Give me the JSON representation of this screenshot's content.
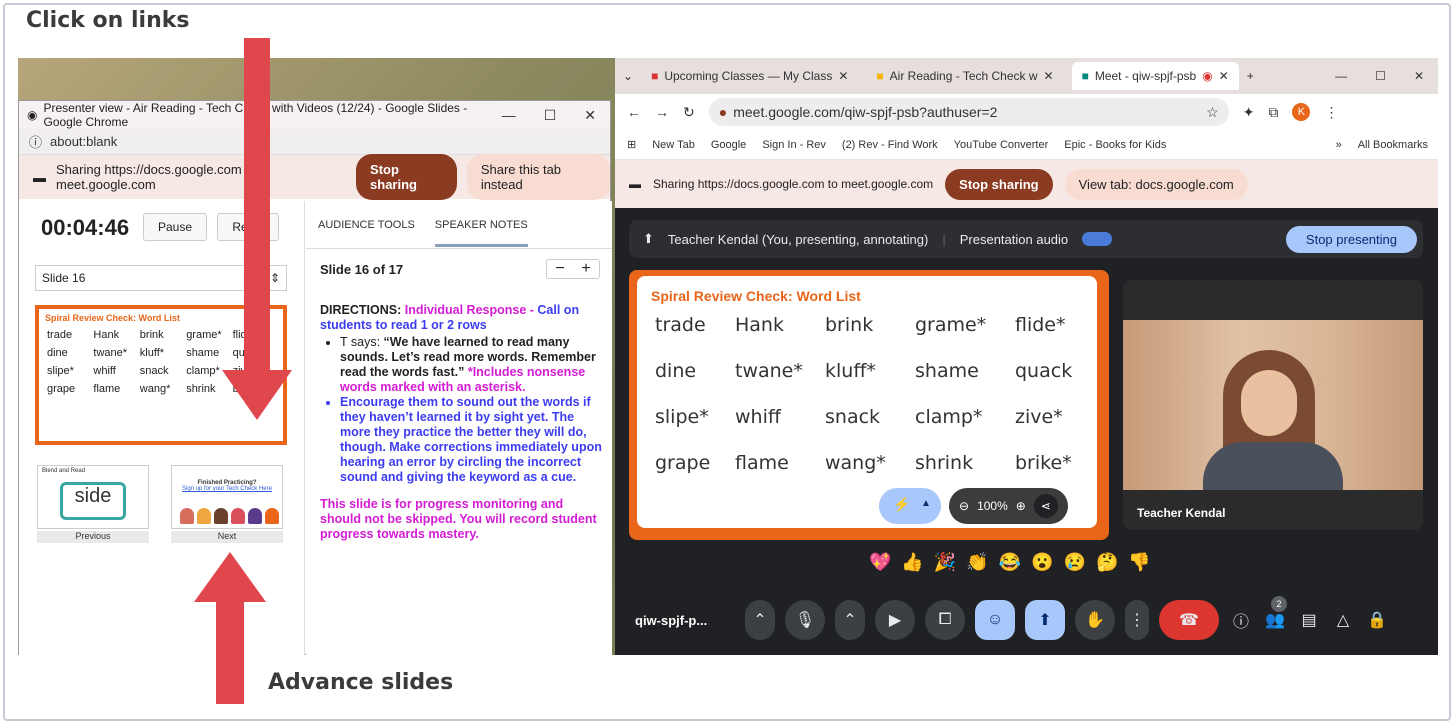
{
  "callouts": {
    "top": "Click on links",
    "bottom": "Advance slides"
  },
  "presenter": {
    "window_title": "Presenter view - Air Reading - Tech Check with Videos (12/24) - Google Slides - Google Chrome",
    "address": "about:blank",
    "share_text": "Sharing https://docs.google.com to meet.google.com",
    "stop_sharing": "Stop sharing",
    "share_tab": "Share this tab instead",
    "timer": "00:04:46",
    "pause": "Pause",
    "reset": "Reset",
    "slide_select": "Slide 16",
    "tabs": [
      "AUDIENCE TOOLS",
      "SPEAKER NOTES"
    ],
    "slide_counter": "Slide 16 of 17",
    "prev_label": "Previous",
    "next_label": "Next",
    "prev_slide_word": "side",
    "next_slide_title": "Finished Practicing?",
    "next_slide_link": "Sign up for your Tech Check Here",
    "prev_slide_title": "Blend and Read",
    "notes": {
      "directions": "DIRECTIONS:",
      "individual": "Individual Response -",
      "call": "Call on students to read 1 or 2 rows",
      "t_says": "T says:",
      "quote": "“We have learned to read many sounds. Let’s read more words. Remember read the words fast.”",
      "nonsense": "*Includes nonsense words marked with an asterisk.",
      "encourage": "Encourage them to sound out the words if they haven’t learned it by sight yet. The more they practice the better they will do, though. Make corrections immediately upon hearing an error by circling the incorrect sound and giving the keyword as a cue.",
      "progress": "This slide is for progress monitoring and should not be skipped. You will record student progress towards mastery."
    }
  },
  "slide": {
    "title": "Spiral Review Check: Word List",
    "words": [
      "trade",
      "Hank",
      "brink",
      "grame*",
      "flide*",
      "dine",
      "twane*",
      "kluff*",
      "shame",
      "quack",
      "slipe*",
      "whiff",
      "snack",
      "clamp*",
      "zive*",
      "grape",
      "flame",
      "wang*",
      "shrink",
      "brike*"
    ]
  },
  "meet": {
    "tabs": [
      "Upcoming Classes — My Class",
      "Air Reading - Tech Check w",
      "Meet - qiw-spjf-psb"
    ],
    "url": "meet.google.com/qiw-spjf-psb?authuser=2",
    "bookmarks": [
      "New Tab",
      "Google",
      "Sign In - Rev",
      "(2) Rev - Find Work",
      "YouTube Converter",
      "Epic - Books for Kids"
    ],
    "all_bookmarks": "All Bookmarks",
    "share_text": "Sharing https://docs.google.com to meet.google.com",
    "stop_sharing": "Stop sharing",
    "view_tab": "View tab: docs.google.com",
    "presenting": "Teacher Kendal (You, presenting, annotating)",
    "presentation_audio": "Presentation audio",
    "stop_presenting": "Stop presenting",
    "zoom": "100%",
    "video_name": "Teacher Kendal",
    "meeting_code": "qiw-spjf-p...",
    "people_count": "2",
    "reactions": [
      "💖",
      "👍",
      "🎉",
      "👏",
      "😂",
      "😮",
      "😢",
      "🤔",
      "👎"
    ]
  },
  "colors": {
    "accent_orange": "#e8651a",
    "arrow_red": "#e0474c",
    "stop_brown": "#8a3b22",
    "meet_dark": "#202124"
  }
}
